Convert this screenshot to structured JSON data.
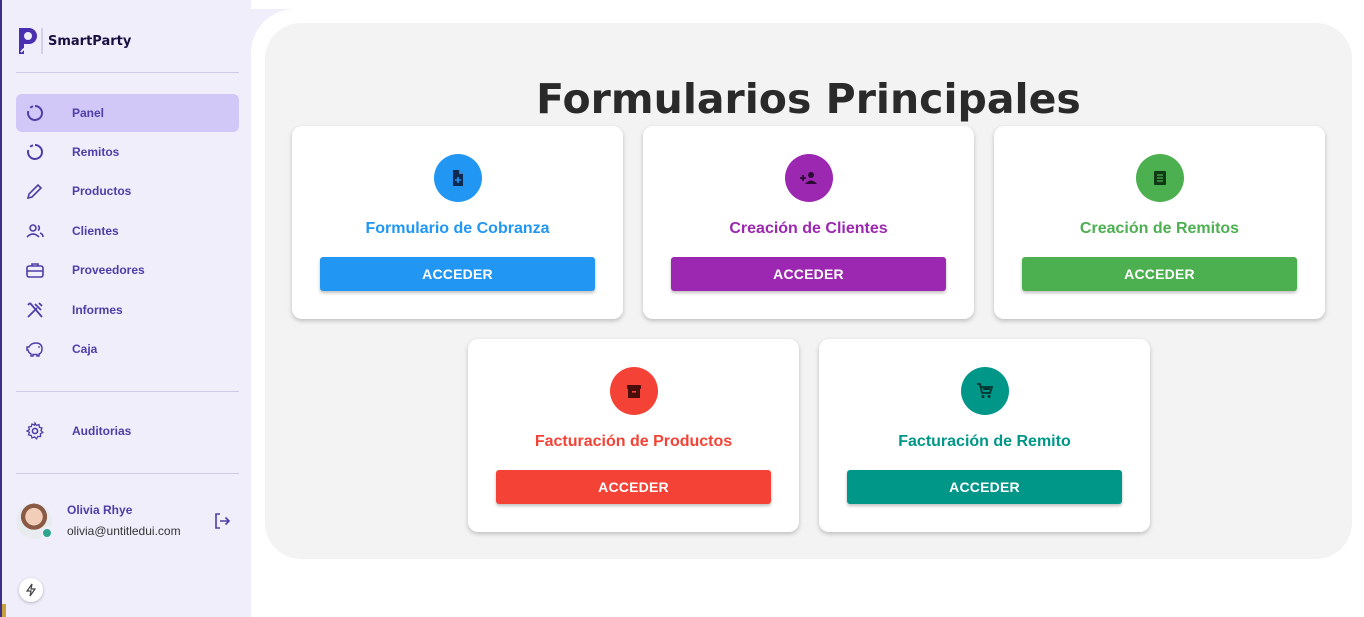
{
  "app": {
    "brand_letter": "P",
    "brand_name": "SmartParty"
  },
  "sidebar": {
    "items": [
      {
        "label": "Panel",
        "icon": "loading-circle-icon",
        "active": true
      },
      {
        "label": "Remitos",
        "icon": "loading-circle-icon",
        "active": false
      },
      {
        "label": "Productos",
        "icon": "pencil-icon",
        "active": false
      },
      {
        "label": "Clientes",
        "icon": "users-icon",
        "active": false
      },
      {
        "label": "Proveedores",
        "icon": "briefcase-icon",
        "active": false
      },
      {
        "label": "Informes",
        "icon": "tools-icon",
        "active": false
      },
      {
        "label": "Caja",
        "icon": "piggy-bank-icon",
        "active": false
      }
    ],
    "secondary_items": [
      {
        "label": "Auditorias",
        "icon": "gear-icon"
      }
    ],
    "user": {
      "name": "Olivia Rhye",
      "email": "olivia@untitledui.com",
      "status_color": "#2fa58e"
    }
  },
  "main": {
    "title": "Formularios Principales",
    "cards": [
      {
        "title": "Formulario de Cobranza",
        "button": "ACCEDER",
        "color": "#2196f3",
        "icon": "document-add-icon"
      },
      {
        "title": "Creación de Clientes",
        "button": "ACCEDER",
        "color": "#9c27b0",
        "icon": "person-add-icon"
      },
      {
        "title": "Creación de Remitos",
        "button": "ACCEDER",
        "color": "#4caf50",
        "icon": "receipt-icon"
      },
      {
        "title": "Facturación de Productos",
        "button": "ACCEDER",
        "color": "#f44336",
        "icon": "archive-icon"
      },
      {
        "title": "Facturación de Remito",
        "button": "ACCEDER",
        "color": "#009688",
        "icon": "cart-icon"
      }
    ]
  }
}
